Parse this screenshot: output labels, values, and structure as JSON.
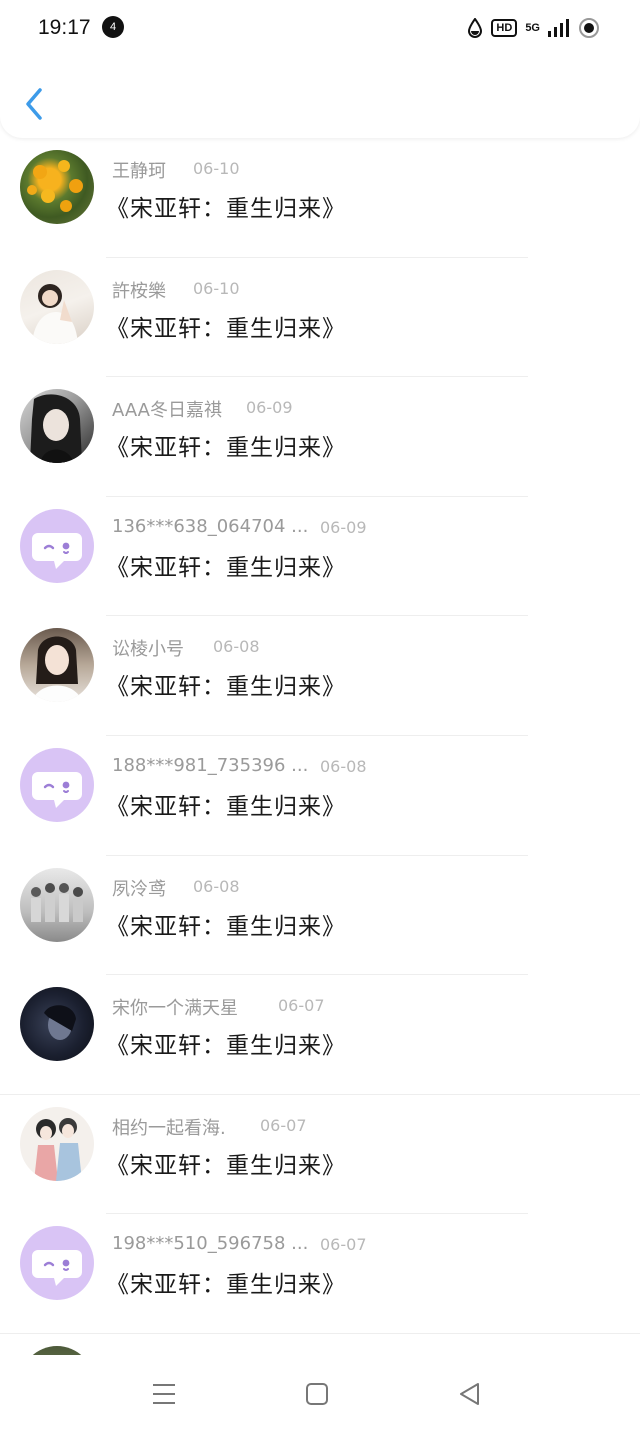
{
  "status_bar": {
    "time": "19:17",
    "badge": "4",
    "hd": "HD",
    "network": "5G"
  },
  "header": {
    "back_icon": "chevron-left-icon",
    "accent_color": "#3d9be9"
  },
  "list": [
    {
      "name": "王静珂",
      "date": "06-10",
      "title": "《宋亚轩：重生归来》",
      "avatar": "photo"
    },
    {
      "name": "許桉樂",
      "date": "06-10",
      "title": "《宋亚轩：重生归来》",
      "avatar": "photo"
    },
    {
      "name": "AAA冬日嘉祺",
      "date": "06-09",
      "title": "《宋亚轩：重生归来》",
      "avatar": "photo"
    },
    {
      "name": "136***638_064704 ...",
      "date": "06-09",
      "title": "《宋亚轩：重生归来》",
      "avatar": "default-chat-icon"
    },
    {
      "name": "讼棱小号",
      "date": "06-08",
      "title": "《宋亚轩：重生归来》",
      "avatar": "photo"
    },
    {
      "name": "188***981_735396 ...",
      "date": "06-08",
      "title": "《宋亚轩：重生归来》",
      "avatar": "default-chat-icon"
    },
    {
      "name": "夙泠鸢",
      "date": "06-08",
      "title": "《宋亚轩：重生归来》",
      "avatar": "photo"
    },
    {
      "name": "宋你一个满天星",
      "date": "06-07",
      "title": "《宋亚轩：重生归来》",
      "avatar": "photo"
    },
    {
      "name": "相约一起看海.",
      "date": "06-07",
      "title": "《宋亚轩：重生归来》",
      "avatar": "photo"
    },
    {
      "name": "198***510_596758 ...",
      "date": "06-07",
      "title": "《宋亚轩：重生归来》",
      "avatar": "default-chat-icon"
    }
  ],
  "nav_bar": {
    "menu_icon": "menu-icon",
    "home_icon": "square-home-icon",
    "back_icon": "triangle-back-icon"
  },
  "colors": {
    "name_gray": "#9a9a9a",
    "date_gray": "#b8b8b8",
    "default_avatar_bg": "#d9c4f5"
  }
}
